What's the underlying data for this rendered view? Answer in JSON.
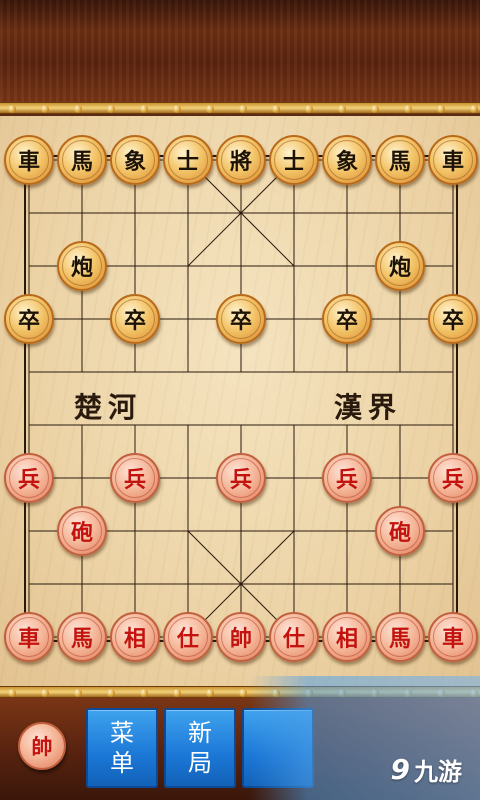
{
  "board": {
    "river_left": "楚河",
    "river_right": "漢界"
  },
  "pieces": {
    "black": [
      {
        "label": "車",
        "col": 0,
        "row": 0
      },
      {
        "label": "馬",
        "col": 1,
        "row": 0
      },
      {
        "label": "象",
        "col": 2,
        "row": 0
      },
      {
        "label": "士",
        "col": 3,
        "row": 0
      },
      {
        "label": "將",
        "col": 4,
        "row": 0
      },
      {
        "label": "士",
        "col": 5,
        "row": 0
      },
      {
        "label": "象",
        "col": 6,
        "row": 0
      },
      {
        "label": "馬",
        "col": 7,
        "row": 0
      },
      {
        "label": "車",
        "col": 8,
        "row": 0
      },
      {
        "label": "炮",
        "col": 1,
        "row": 2
      },
      {
        "label": "炮",
        "col": 7,
        "row": 2
      },
      {
        "label": "卒",
        "col": 0,
        "row": 3
      },
      {
        "label": "卒",
        "col": 2,
        "row": 3
      },
      {
        "label": "卒",
        "col": 4,
        "row": 3
      },
      {
        "label": "卒",
        "col": 6,
        "row": 3
      },
      {
        "label": "卒",
        "col": 8,
        "row": 3
      }
    ],
    "red": [
      {
        "label": "兵",
        "col": 0,
        "row": 6
      },
      {
        "label": "兵",
        "col": 2,
        "row": 6
      },
      {
        "label": "兵",
        "col": 4,
        "row": 6
      },
      {
        "label": "兵",
        "col": 6,
        "row": 6
      },
      {
        "label": "兵",
        "col": 8,
        "row": 6
      },
      {
        "label": "砲",
        "col": 1,
        "row": 7
      },
      {
        "label": "砲",
        "col": 7,
        "row": 7
      },
      {
        "label": "車",
        "col": 0,
        "row": 9
      },
      {
        "label": "馬",
        "col": 1,
        "row": 9
      },
      {
        "label": "相",
        "col": 2,
        "row": 9
      },
      {
        "label": "仕",
        "col": 3,
        "row": 9
      },
      {
        "label": "帥",
        "col": 4,
        "row": 9
      },
      {
        "label": "仕",
        "col": 5,
        "row": 9
      },
      {
        "label": "相",
        "col": 6,
        "row": 9
      },
      {
        "label": "馬",
        "col": 7,
        "row": 9
      },
      {
        "label": "車",
        "col": 8,
        "row": 9
      }
    ]
  },
  "footer": {
    "turn_indicator": "帥",
    "menu_button": [
      "菜",
      "单"
    ],
    "new_game_button": [
      "新",
      "局"
    ],
    "watermark_logo": "9",
    "watermark_text": "九游"
  },
  "colors": {
    "red_piece_text": "#c4120e",
    "black_piece_text": "#1c1206",
    "button_blue": "#1b77d6",
    "board_bg": "#ecd3a6",
    "frame_wood": "#5b2a12"
  }
}
